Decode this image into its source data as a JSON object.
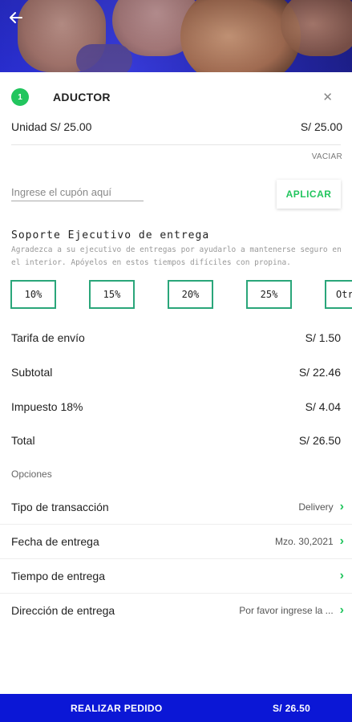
{
  "header": {
    "back_icon": "arrow-left-icon"
  },
  "item": {
    "qty": "1",
    "name": "ADUCTOR",
    "close_icon": "close-icon",
    "unit_label": "Unidad S/ 25.00",
    "unit_total": "S/ 25.00",
    "clear_label": "VACIAR"
  },
  "coupon": {
    "placeholder": "Ingrese el cupón aquí",
    "apply_label": "APLICAR"
  },
  "support": {
    "title": "Soporte Ejecutivo de entrega",
    "description": "Agradezca a su ejecutivo de entregas por ayudarlo a mantenerse seguro en el interior. Apóyelos en estos tiempos difíciles con propina.",
    "tips": [
      "10%",
      "15%",
      "20%",
      "25%",
      "Otr"
    ]
  },
  "summary": {
    "shipping_label": "Tarifa de envío",
    "shipping_value": "S/ 1.50",
    "subtotal_label": "Subtotal",
    "subtotal_value": "S/ 22.46",
    "tax_label": "Impuesto 18%",
    "tax_value": "S/ 4.04",
    "total_label": "Total",
    "total_value": "S/ 26.50"
  },
  "options": {
    "label": "Opciones",
    "rows": [
      {
        "label": "Tipo de transacción",
        "value": "Delivery"
      },
      {
        "label": "Fecha de entrega",
        "value": "Mzo. 30,2021"
      },
      {
        "label": "Tiempo de entrega",
        "value": ""
      },
      {
        "label": "Dirección de entrega",
        "value": "Por favor ingrese la ..."
      }
    ]
  },
  "footer": {
    "place_order_label": "REALIZAR PEDIDO",
    "total": "S/ 26.50"
  },
  "colors": {
    "accent": "#22c55e",
    "footer": "#0b17d6",
    "tip_border": "#2aa67a"
  }
}
